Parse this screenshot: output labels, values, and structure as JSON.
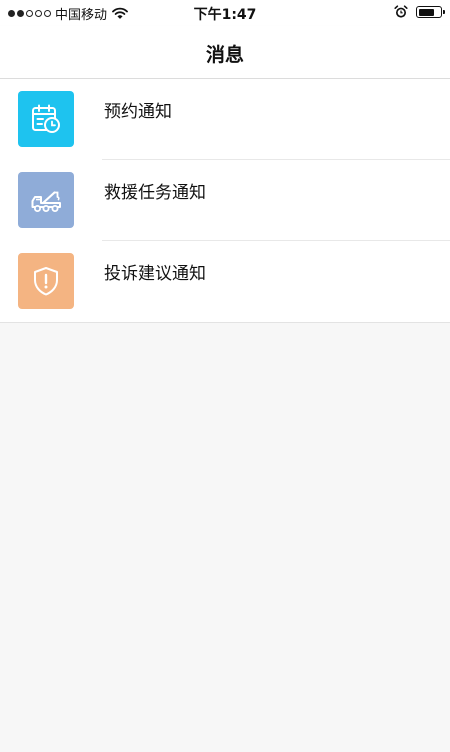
{
  "status_bar": {
    "carrier": "中国移动",
    "time": "下午1:47",
    "battery_level_percent": 75,
    "icons": [
      "signal-dots",
      "wifi-icon",
      "alarm-icon",
      "battery-icon"
    ]
  },
  "header": {
    "title": "消息"
  },
  "notifications": [
    {
      "label": "预约通知",
      "icon": "calendar-clock-icon",
      "color": "#1EC3EF"
    },
    {
      "label": "救援任务通知",
      "icon": "tow-truck-icon",
      "color": "#8FACD8"
    },
    {
      "label": "投诉建议通知",
      "icon": "shield-alert-icon",
      "color": "#F4B482"
    }
  ]
}
